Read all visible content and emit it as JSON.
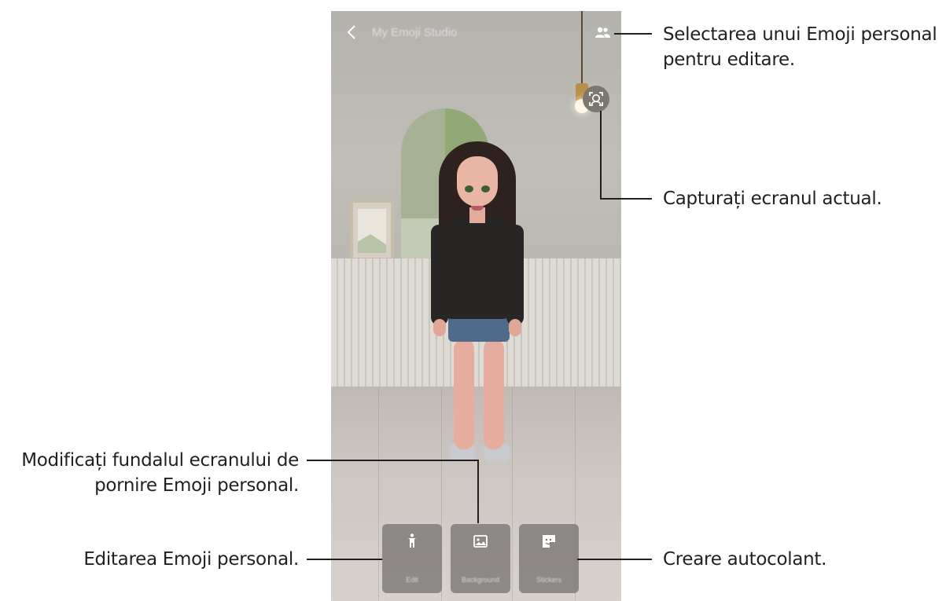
{
  "screen": {
    "title": "My Emoji Studio",
    "back_icon": "chevron-left-icon",
    "select_icon": "people-icon",
    "capture_icon": "face-capture-icon",
    "buttons": [
      {
        "label": "Edit",
        "icon": "person-icon"
      },
      {
        "label": "Background",
        "icon": "image-icon"
      },
      {
        "label": "Stickers",
        "icon": "sticker-icon"
      }
    ]
  },
  "callouts": {
    "select_line1": "Selectarea unui Emoji personal",
    "select_line2": "pentru editare.",
    "capture": "Capturați ecranul actual.",
    "background_line1": "Modificați fundalul ecranului de",
    "background_line2": "pornire Emoji personal.",
    "edit": "Editarea Emoji personal.",
    "sticker": "Creare autocolant."
  },
  "colors": {
    "text": "#231f20",
    "button_bg": "#787472",
    "accent_wall": "#93a877"
  }
}
